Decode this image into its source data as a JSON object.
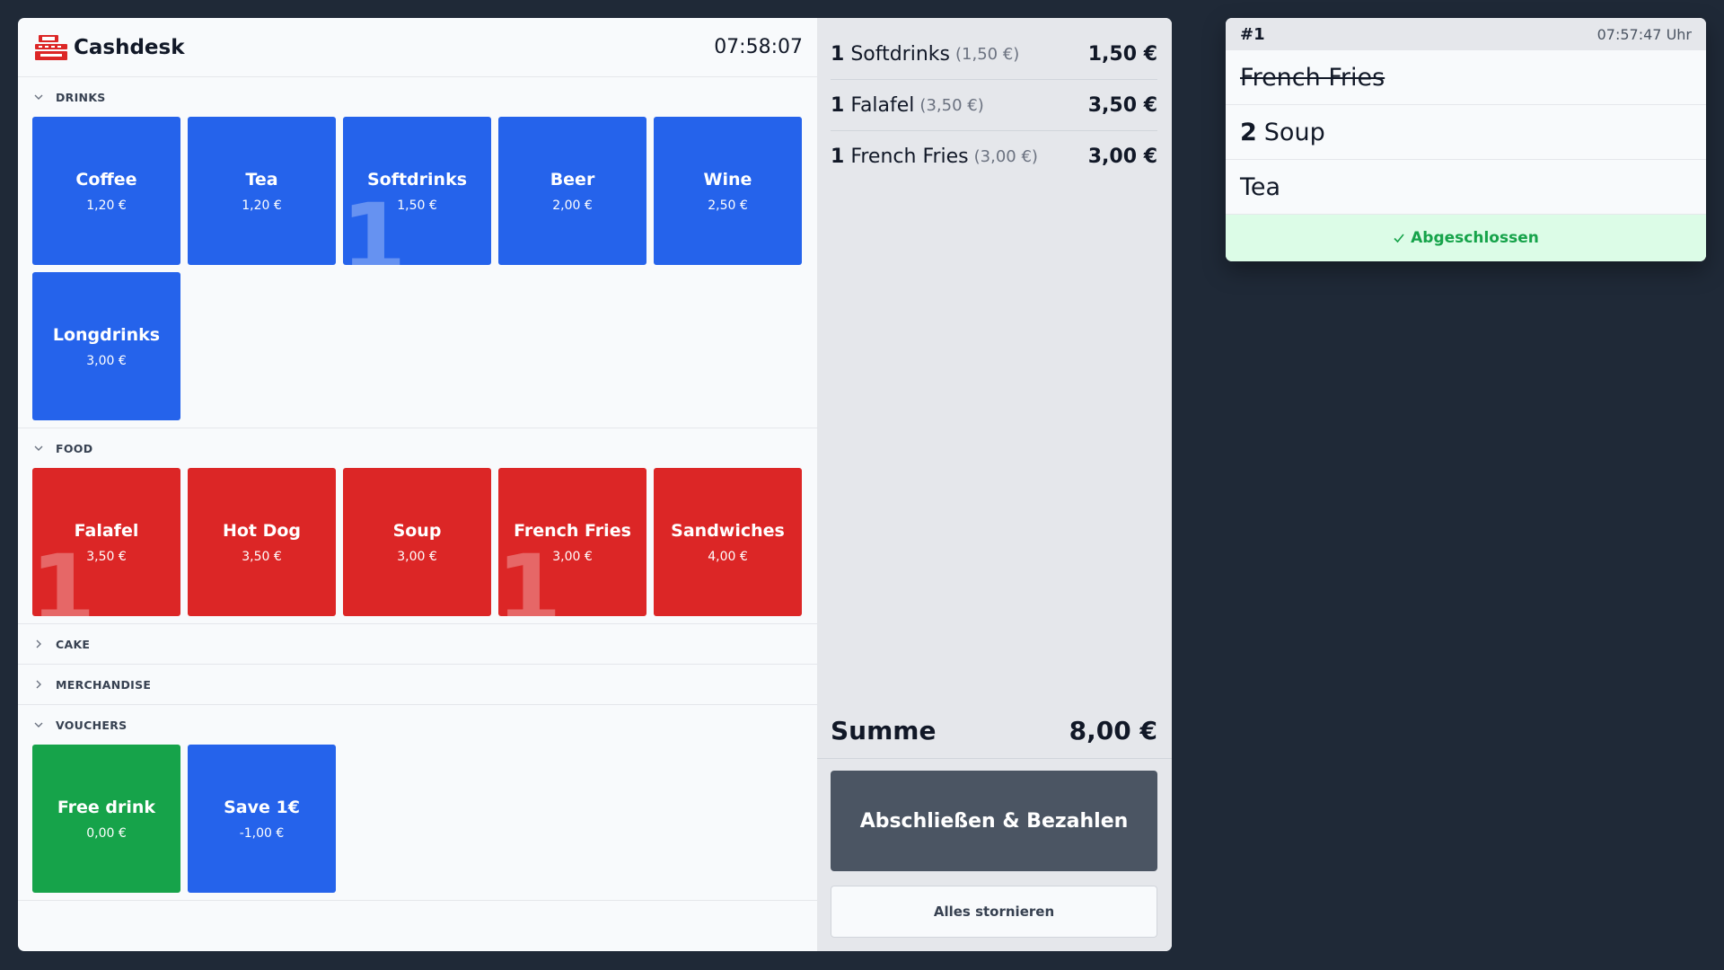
{
  "header": {
    "title": "Cashdesk",
    "clock": "07:58:07",
    "logo_icon": "cash-register-icon"
  },
  "sections": [
    {
      "label": "DRINKS",
      "expanded": true,
      "products": [
        {
          "name": "Coffee",
          "price": "1,20 €",
          "count": ""
        },
        {
          "name": "Tea",
          "price": "1,20 €",
          "count": ""
        },
        {
          "name": "Softdrinks",
          "price": "1,50 €",
          "count": "1"
        },
        {
          "name": "Beer",
          "price": "2,00 €",
          "count": ""
        },
        {
          "name": "Wine",
          "price": "2,50 €",
          "count": ""
        },
        {
          "name": "Longdrinks",
          "price": "3,00 €",
          "count": ""
        }
      ]
    },
    {
      "label": "FOOD",
      "expanded": true,
      "products": [
        {
          "name": "Falafel",
          "price": "3,50 €",
          "count": "1"
        },
        {
          "name": "Hot Dog",
          "price": "3,50 €",
          "count": ""
        },
        {
          "name": "Soup",
          "price": "3,00 €",
          "count": ""
        },
        {
          "name": "French Fries",
          "price": "3,00 €",
          "count": "1"
        },
        {
          "name": "Sandwiches",
          "price": "4,00 €",
          "count": ""
        }
      ]
    },
    {
      "label": "CAKE",
      "expanded": false,
      "products": []
    },
    {
      "label": "MERCHANDISE",
      "expanded": false,
      "products": []
    },
    {
      "label": "VOUCHERS",
      "expanded": true,
      "products": [
        {
          "name": "Free drink",
          "price": "0,00 €",
          "count": ""
        },
        {
          "name": "Save 1€",
          "price": "-1,00 €",
          "count": ""
        }
      ]
    }
  ],
  "order": {
    "lines": [
      {
        "qty": "1",
        "name": "Softdrinks",
        "unit": "(1,50 €)",
        "total": "1,50 €"
      },
      {
        "qty": "1",
        "name": "Falafel",
        "unit": "(3,50 €)",
        "total": "3,50 €"
      },
      {
        "qty": "1",
        "name": "French Fries",
        "unit": "(3,00 €)",
        "total": "3,00 €"
      }
    ],
    "sum_label": "Summe",
    "sum_value": "8,00 €",
    "pay_label": "Abschließen & Bezahlen",
    "cancel_label": "Alles stornieren"
  },
  "ticket": {
    "number": "#1",
    "time": "07:57:47 Uhr",
    "items": [
      {
        "qty": "",
        "name": "French Fries",
        "done": true
      },
      {
        "qty": "2",
        "name": "Soup",
        "done": false
      },
      {
        "qty": "",
        "name": "Tea",
        "done": false
      }
    ],
    "status": "Abgeschlossen"
  },
  "colors": {
    "drinks": "#2563eb",
    "food": "#dc2626",
    "voucher_free": "#16a34a",
    "voucher_save": "#2563eb",
    "background": "#1f2937",
    "pay_button": "#4b5563",
    "status_ok": "#16a34a"
  }
}
